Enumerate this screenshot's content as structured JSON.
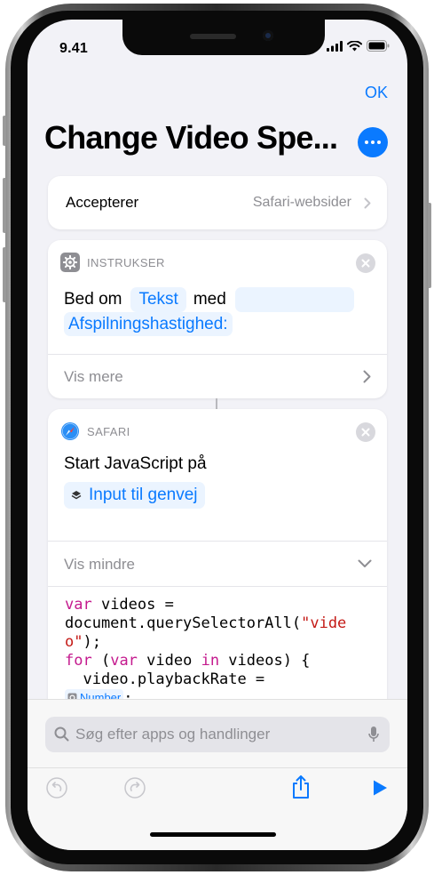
{
  "status": {
    "time": "9.41"
  },
  "header": {
    "ok_label": "OK",
    "title": "Change Video Spe..."
  },
  "accept": {
    "label": "Accepterer",
    "value": "Safari-websider"
  },
  "instruction": {
    "section_label": "INSTRUKSER",
    "prefix": "Bed om",
    "token": "Tekst",
    "middle": "med",
    "prompt": "Afspilningshastighed:",
    "show_more": "Vis mere"
  },
  "safari": {
    "section_label": "SAFARI",
    "action": "Start JavaScript på",
    "input_token": "Input til genvej",
    "show_less": "Vis mindre",
    "code": {
      "l1_kw": "var",
      "l1_rest": " videos =",
      "l2": "document.querySelectorAll(",
      "l2_str": "\"vide",
      "l3_str": "o\"",
      "l3_rest": ");",
      "l4_kw": "for",
      "l4_a": " (",
      "l4_kw2": "var",
      "l4_b": " video ",
      "l4_kw3": "in",
      "l4_c": " videos) {",
      "l5": "  video.playbackRate =",
      "l6_token": "Number",
      "l6_rest": ";",
      "l7": "}"
    }
  },
  "search": {
    "placeholder": "Søg efter apps og handlinger"
  },
  "colors": {
    "accent": "#0a7aff",
    "keyword": "#c41a8e",
    "string": "#c41a16"
  }
}
